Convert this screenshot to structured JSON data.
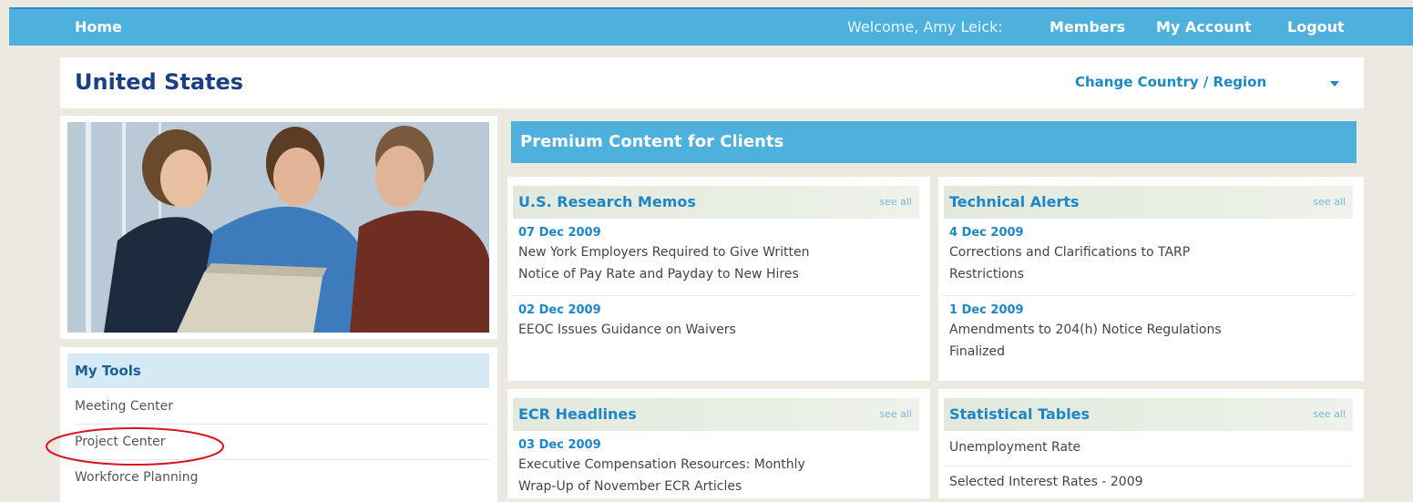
{
  "topbar": {
    "home": "Home",
    "welcome": "Welcome, Amy Leick:",
    "links": [
      "Members",
      "My Account",
      "Logout"
    ]
  },
  "country": {
    "title": "United States",
    "change_label": "Change Country / Region"
  },
  "tools": {
    "heading": "My Tools",
    "items": [
      "Meeting Center",
      "Project Center",
      "Workforce Planning"
    ]
  },
  "premium": {
    "heading": "Premium Content for Clients"
  },
  "memos": {
    "title": "U.S. Research Memos",
    "see_all": "see all",
    "items": [
      {
        "date": "07 Dec 2009",
        "line1": "New York Employers Required to Give Written",
        "line2": "Notice of Pay Rate and Payday to New Hires"
      },
      {
        "date": "02 Dec 2009",
        "line1": "EEOC Issues Guidance on Waivers",
        "line2": ""
      }
    ]
  },
  "alerts": {
    "title": "Technical Alerts",
    "see_all": "see all",
    "items": [
      {
        "date": "4 Dec 2009",
        "line1": "Corrections and Clarifications to TARP",
        "line2": "Restrictions"
      },
      {
        "date": "1 Dec 2009",
        "line1": "Amendments to 204(h) Notice Regulations",
        "line2": "Finalized"
      }
    ]
  },
  "ecr": {
    "title": "ECR Headlines",
    "see_all": "see all",
    "items": [
      {
        "date": "03 Dec 2009",
        "line1": "Executive Compensation Resources: Monthly",
        "line2": "Wrap-Up of November ECR Articles"
      }
    ]
  },
  "stats": {
    "title": "Statistical Tables",
    "see_all": "see all",
    "items": [
      "Unemployment Rate",
      "Selected Interest Rates - 2009"
    ]
  },
  "colors": {
    "topbar": "#4eb0dd",
    "accent_blue": "#1c86c7",
    "title_navy": "#1b3f86",
    "highlight_circle": "#d9141b"
  }
}
